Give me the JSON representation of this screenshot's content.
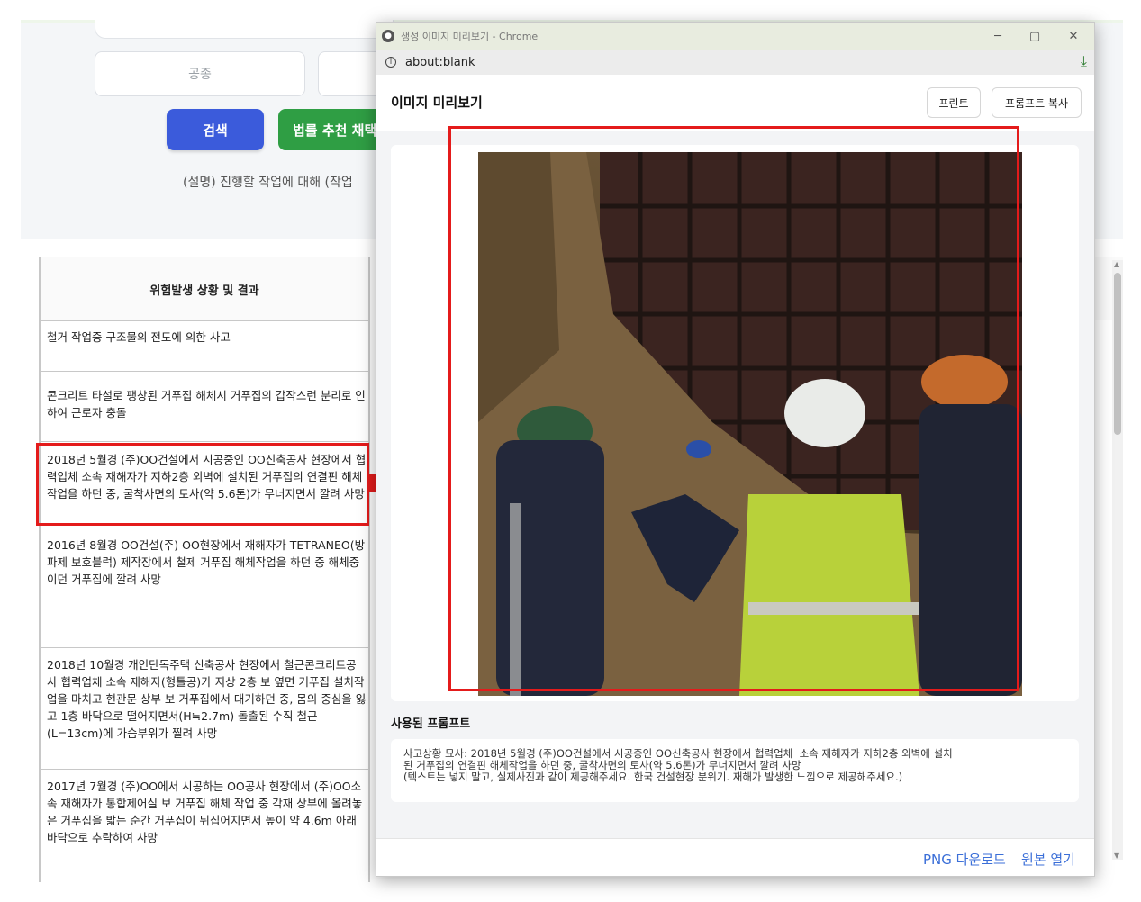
{
  "app": {
    "field_trade_placeholder": "공종",
    "search_button": "검색",
    "law_button": "법률 추천 채택",
    "description": "(설명) 진행할 작업에 대해 (작업",
    "table_header": "위험발생 상황 및 결과",
    "rows": [
      "철거 작업중 구조물의 전도에 의한 사고",
      "콘크리트 타설로 팽창된 거푸집 해체시 거푸집의 갑작스런 분리로 인하여 근로자 충돌",
      "2018년 5월경 (주)OO건설에서 시공중인 OO신축공사 현장에서 협력업체 소속 재해자가 지하2층 외벽에 설치된 거푸집의 연결핀 해체작업을 하던 중, 굴착사면의 토사(약 5.6톤)가 무너지면서 깔려 사망",
      "2016년 8월경 OO건설(주) OO현장에서 재해자가 TETRANEO(방파제 보호블럭) 제작장에서 철제 거푸집 해체작업을 하던 중 해체중이던 거푸집에 깔려 사망",
      "2018년 10월경 개인단독주택 신축공사 현장에서 철근콘크리트공사 협력업체 소속 재해자(형틀공)가 지상 2층 보 옆면 거푸집 설치작업을 마치고 현관문 상부 보 거푸집에서 대기하던 중, 몸의 중심을 잃고 1층 바닥으로 떨어지면서(H≒2.7m) 돌출된 수직 철근(L=13cm)에 가슴부위가 찔려 사망",
      "2017년 7월경 (주)OO에서 시공하는 OO공사 현장에서 (주)OO소속 재해자가 통합제어실 보 거푸집 해체 작업 중 각재 상부에 올려놓은 거푸집을 밟는 순간 거푸집이 뒤집어지면서 높이 약 4.6m 아래 바닥으로 추락하여 사망"
    ]
  },
  "popup": {
    "window_title": "생성 이미지 미리보기 - Chrome",
    "url": "about:blank",
    "header_title": "이미지 미리보기",
    "print_button": "프린트",
    "copy_prompt_button": "프롬프트 복사",
    "prompt_label": "사용된 프롬프트",
    "prompt_text": "사고상황 묘사: 2018년 5월경 (주)OO건설에서 시공중인 OO신축공사 현장에서 협력업체  소속 재해자가 지하2층 외벽에 설치\n된 거푸집의 연결핀 해체작업을 하던 중, 굴착사면의 토사(약 5.6톤)가 무너지면서 깔려 사망\n(텍스트는 넣지 말고, 실제사진과 같이 제공해주세요. 한국 건설현장 분위기. 재해가 발생한 느낌으로 제공해주세요.)",
    "png_download": "PNG 다운로드",
    "open_original": "원본 열기"
  },
  "colors": {
    "search_blue": "#3b5bdb",
    "law_green": "#2f9e44",
    "highlight_red": "#e41b1b",
    "link_blue": "#3b6fd8"
  }
}
